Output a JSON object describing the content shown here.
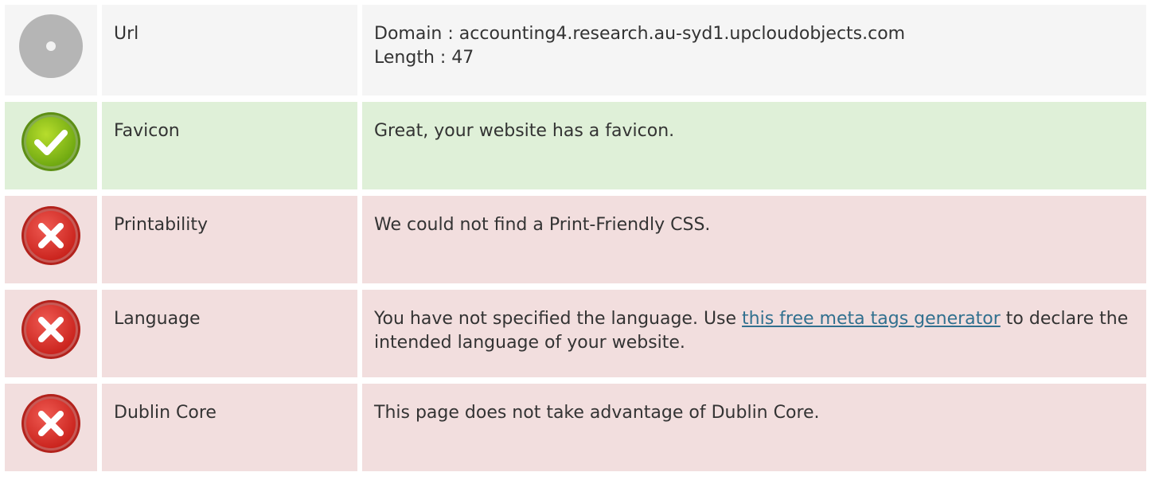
{
  "rows": [
    {
      "status": "neutral",
      "icon": "grey-circle-icon",
      "label": "Url",
      "lines": [
        "Domain : accounting4.research.au-syd1.upcloudobjects.com",
        "Length : 47"
      ]
    },
    {
      "status": "ok",
      "icon": "green-check-icon",
      "label": "Favicon",
      "text": "Great, your website has a favicon."
    },
    {
      "status": "error",
      "icon": "red-x-icon",
      "label": "Printability",
      "text": "We could not find a Print-Friendly CSS."
    },
    {
      "status": "error",
      "icon": "red-x-icon",
      "label": "Language",
      "text_before": "You have not specified the language. Use ",
      "link_text": "this free meta tags generator",
      "text_after": " to declare the intended language of your website."
    },
    {
      "status": "error",
      "icon": "red-x-icon",
      "label": "Dublin Core",
      "text": "This page does not take advantage of Dublin Core."
    }
  ],
  "colors": {
    "neutral_bg": "#f5f5f5",
    "ok_bg": "#dff0d8",
    "error_bg": "#f2dede",
    "link": "#31708f",
    "text": "#333333"
  }
}
